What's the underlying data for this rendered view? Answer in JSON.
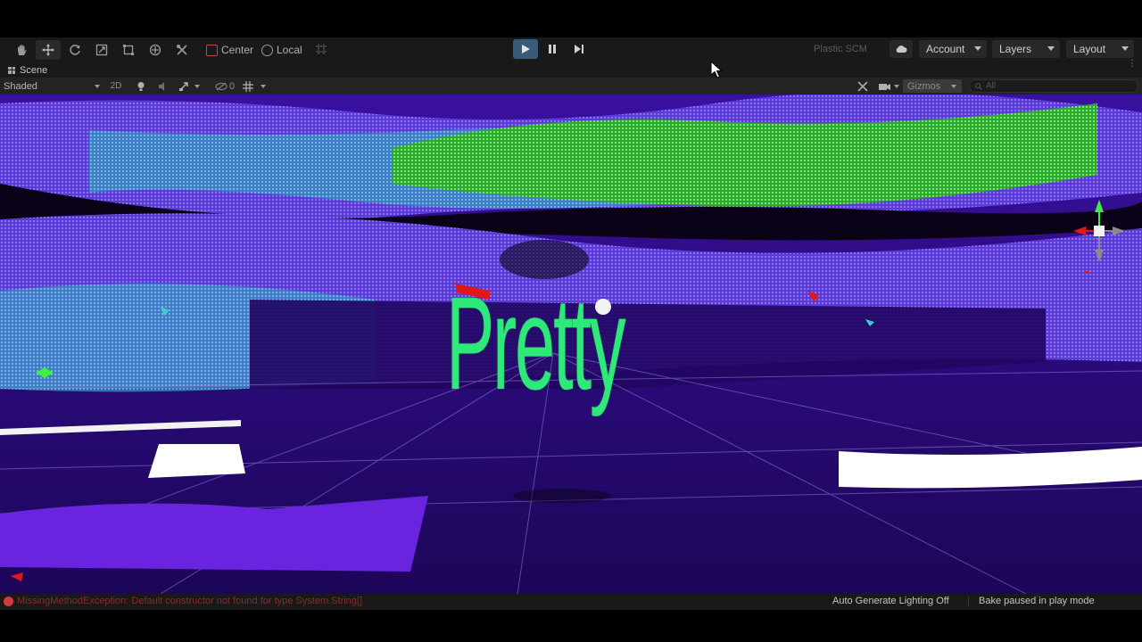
{
  "toolbar": {
    "tools": [
      {
        "name": "hand-tool-icon"
      },
      {
        "name": "move-tool-icon"
      },
      {
        "name": "rotate-tool-icon"
      },
      {
        "name": "scale-tool-icon"
      },
      {
        "name": "rect-tool-icon"
      },
      {
        "name": "transform-tool-icon"
      },
      {
        "name": "custom-tool-icon"
      }
    ],
    "pivot_mode": "Center",
    "pivot_rotation": "Local",
    "play_state": "playing",
    "plastic_scm": "Plastic SCM",
    "account": "Account",
    "layers": "Layers",
    "layout": "Layout"
  },
  "scene_tab": {
    "label": "Scene"
  },
  "scene_toolbar": {
    "draw_mode": "Shaded",
    "mode_2d": "2D",
    "hidden_count": "0",
    "gizmos": "Gizmos",
    "search_placeholder": "All"
  },
  "viewport": {
    "text_3d": "Pretty",
    "text_color": "#2fe87a"
  },
  "status_bar": {
    "error_message": "MissingMethodException: Default constructor not found for type System.String[]",
    "lighting": "Auto Generate Lighting Off",
    "bake_status": "Bake paused in play mode"
  },
  "colors": {
    "accent_play": "#3a5a7a",
    "error_red": "#d23b3b",
    "scene_purple": "#2a0a6e",
    "scene_green": "#3ef03e",
    "scene_cyan": "#3ad0d0"
  }
}
